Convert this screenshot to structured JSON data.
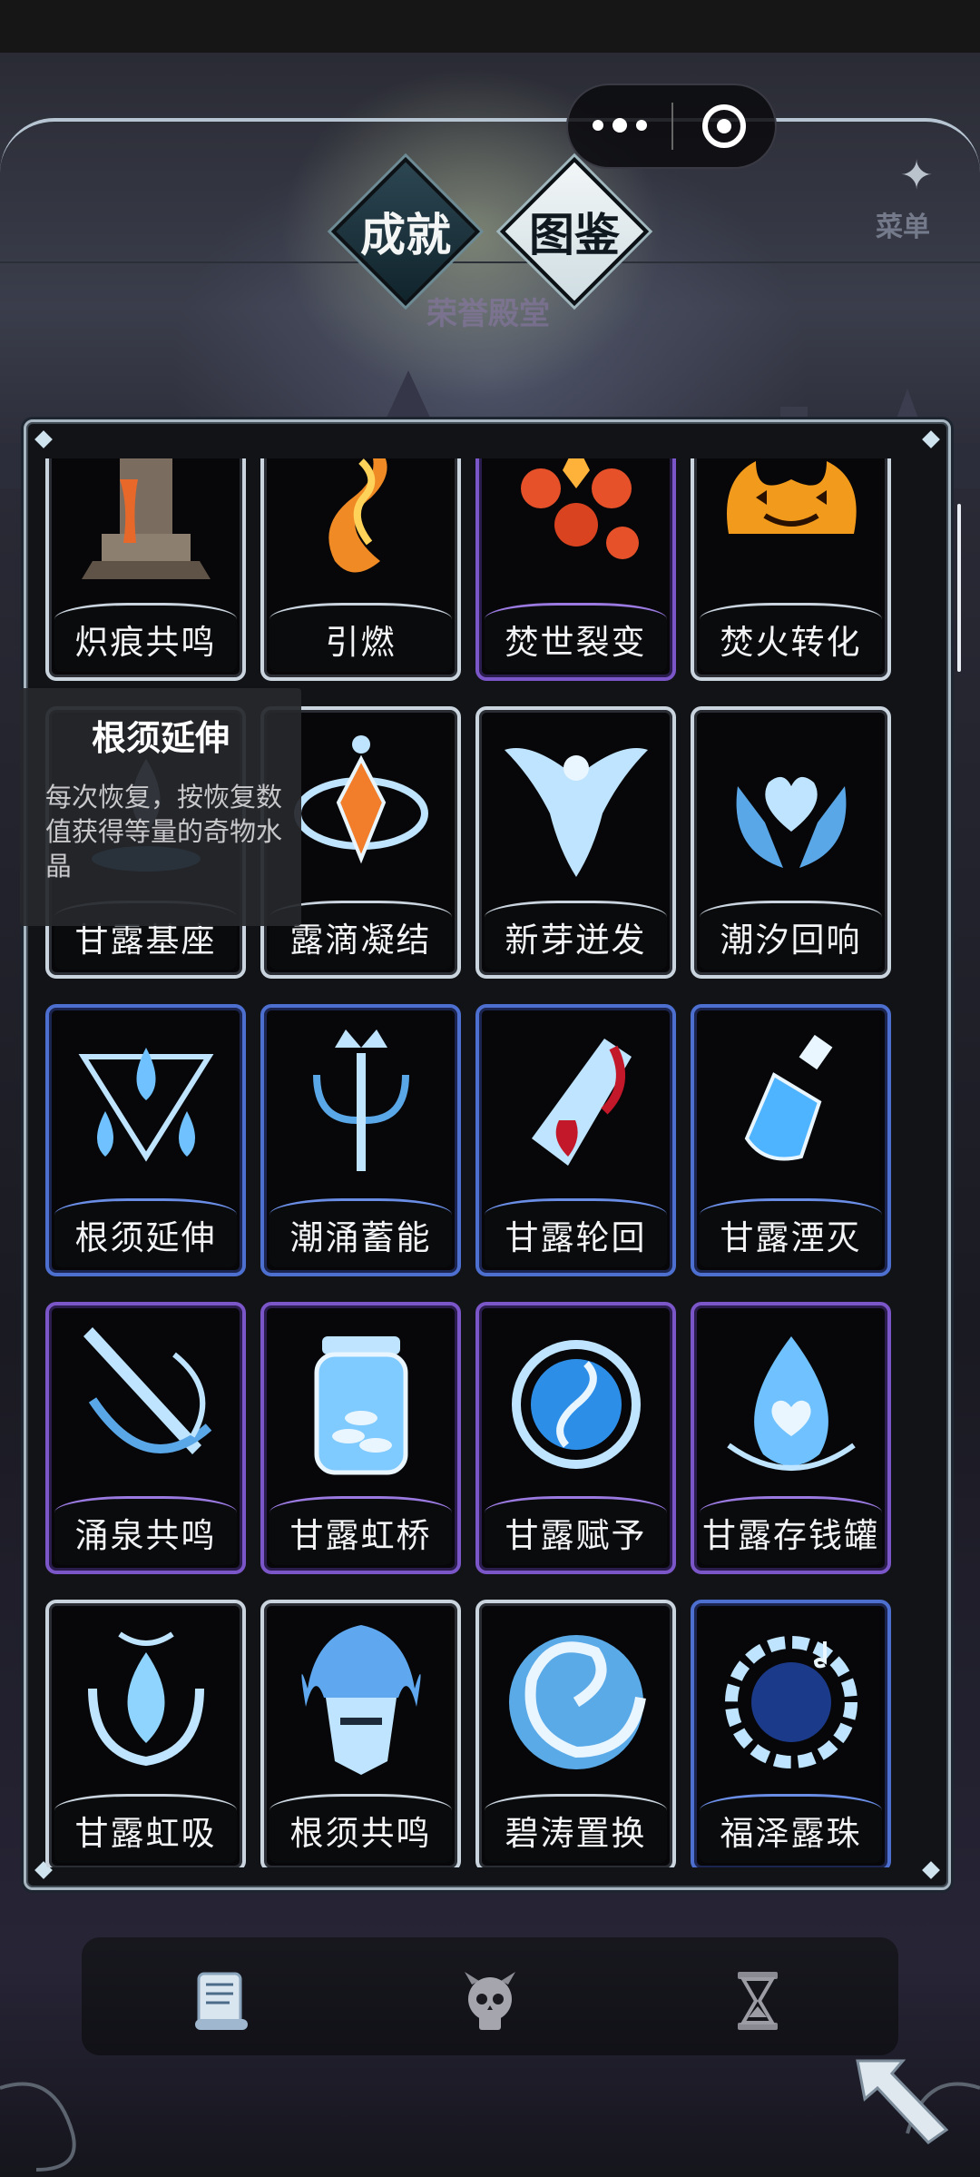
{
  "header": {
    "tabs": [
      {
        "label": "成就",
        "active": false
      },
      {
        "label": "图鉴",
        "active": true
      }
    ],
    "section_title": "荣誉殿堂",
    "menu_label": "菜单"
  },
  "capsule": {
    "more_icon": "more-dots-icon",
    "close_icon": "target-close-icon"
  },
  "cards": [
    {
      "name": "炽痕共鸣",
      "frame": "white",
      "icon": "lava-pillar-icon"
    },
    {
      "name": "引燃",
      "frame": "white",
      "icon": "fire-swirl-icon"
    },
    {
      "name": "焚世裂变",
      "frame": "purple",
      "icon": "fireball-cluster-icon"
    },
    {
      "name": "焚火转化",
      "frame": "white",
      "icon": "jack-o-lantern-flames-icon"
    },
    {
      "name": "甘露基座",
      "frame": "white",
      "icon": "dew-pedestal-icon"
    },
    {
      "name": "露滴凝结",
      "frame": "white",
      "icon": "crystal-orbit-icon"
    },
    {
      "name": "新芽迸发",
      "frame": "white",
      "icon": "ice-phoenix-icon"
    },
    {
      "name": "潮汐回响",
      "frame": "white",
      "icon": "hands-heart-icon"
    },
    {
      "name": "根须延伸",
      "frame": "blue",
      "icon": "triple-droplet-icon"
    },
    {
      "name": "潮涌蓄能",
      "frame": "blue",
      "icon": "crowned-trident-icon"
    },
    {
      "name": "甘露轮回",
      "frame": "blue",
      "icon": "blood-crystal-icon"
    },
    {
      "name": "甘露湮灭",
      "frame": "blue",
      "icon": "potion-bottle-icon"
    },
    {
      "name": "涌泉共鸣",
      "frame": "purple",
      "icon": "ice-dagger-icon"
    },
    {
      "name": "甘露虹桥",
      "frame": "purple",
      "icon": "coin-jar-icon"
    },
    {
      "name": "甘露赋予",
      "frame": "purple",
      "icon": "vortex-orb-icon"
    },
    {
      "name": "甘露存钱罐",
      "frame": "purple",
      "icon": "droplet-heart-icon"
    },
    {
      "name": "甘露虹吸",
      "frame": "white",
      "icon": "lotus-drop-icon"
    },
    {
      "name": "根须共鸣",
      "frame": "white",
      "icon": "flame-helmet-icon"
    },
    {
      "name": "碧涛置换",
      "frame": "white",
      "icon": "spiral-wave-icon"
    },
    {
      "name": "福泽露珠",
      "frame": "blue",
      "icon": "music-wreath-icon"
    }
  ],
  "tooltip": {
    "title": "根须延伸",
    "description": "每次恢复，按恢复数值获得等量的奇物水晶"
  },
  "bottom_nav": [
    {
      "icon": "scroll-icon",
      "active": true
    },
    {
      "icon": "skull-icon",
      "active": false
    },
    {
      "icon": "hourglass-icon",
      "active": false
    }
  ],
  "colors": {
    "panel_border": "#a8b6c2",
    "blue_frame": "#4d6fd0",
    "purple_frame": "#7a56c8",
    "white_frame": "#c9d4de"
  }
}
